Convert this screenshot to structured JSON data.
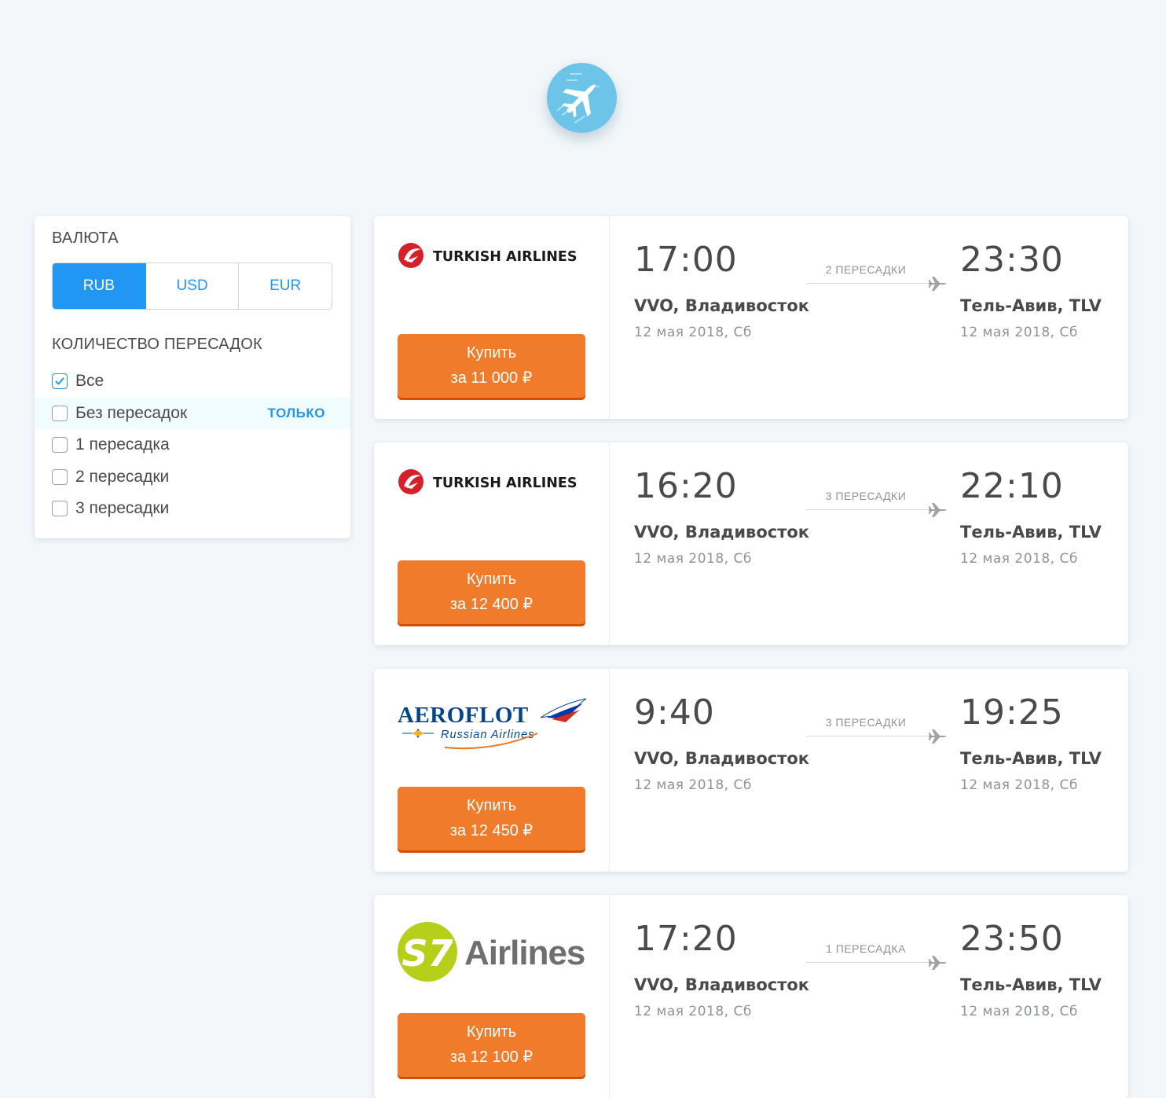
{
  "filters": {
    "currency_title": "ВАЛЮТА",
    "currencies": [
      {
        "code": "RUB",
        "active": true
      },
      {
        "code": "USD",
        "active": false
      },
      {
        "code": "EUR",
        "active": false
      }
    ],
    "stops_title": "КОЛИЧЕСТВО ПЕРЕСАДОК",
    "only_label": "ТОЛЬКО",
    "stops": [
      {
        "label": "Все",
        "checked": true
      },
      {
        "label": "Без пересадок",
        "checked": false
      },
      {
        "label": "1 пересадка",
        "checked": false
      },
      {
        "label": "2 пересадки",
        "checked": false
      },
      {
        "label": "3 пересадки",
        "checked": false
      }
    ]
  },
  "colors": {
    "accent": "#2196f3",
    "button": "#f07b2b",
    "logo_bg": "#6cc4e8"
  },
  "tickets": [
    {
      "carrier": "TURKISH AIRLINES",
      "buy": "Купить",
      "price": "за 11 000 ₽",
      "departure_time": "17:00",
      "departure_place": "VVO, Владивосток",
      "departure_date": "12 мая 2018, Сб",
      "stops": "2 ПЕРЕСАДКИ",
      "arrival_time": "23:30",
      "arrival_place": "Тель-Авив, TLV",
      "arrival_date": "12 мая 2018, Сб"
    },
    {
      "carrier": "TURKISH AIRLINES",
      "buy": "Купить",
      "price": "за 12 400 ₽",
      "departure_time": "16:20",
      "departure_place": "VVO, Владивосток",
      "departure_date": "12 мая 2018, Сб",
      "stops": "3 ПЕРЕСАДКИ",
      "arrival_time": "22:10",
      "arrival_place": "Тель-Авив, TLV",
      "arrival_date": "12 мая 2018, Сб"
    },
    {
      "carrier": "AEROFLOT",
      "carrier_sub": "Russian Airlines",
      "buy": "Купить",
      "price": "за 12 450 ₽",
      "departure_time": "9:40",
      "departure_place": "VVO, Владивосток",
      "departure_date": "12 мая 2018, Сб",
      "stops": "3 ПЕРЕСАДКИ",
      "arrival_time": "19:25",
      "arrival_place": "Тель-Авив, TLV",
      "arrival_date": "12 мая 2018, Сб"
    },
    {
      "carrier": "S7",
      "carrier_sub": "Airlines",
      "buy": "Купить",
      "price": "за 12 100 ₽",
      "departure_time": "17:20",
      "departure_place": "VVO, Владивосток",
      "departure_date": "12 мая 2018, Сб",
      "stops": "1 ПЕРЕСАДКА",
      "arrival_time": "23:50",
      "arrival_place": "Тель-Авив, TLV",
      "arrival_date": "12 мая 2018, Сб"
    }
  ]
}
